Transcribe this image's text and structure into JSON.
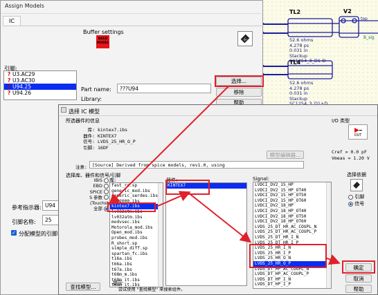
{
  "schematic": {
    "tl2": {
      "name": "TL2",
      "props": "52.6 ohms\n4.278 ps\n0.031 in\nStackup\nSC1254_3_D1-D"
    },
    "tl4": {
      "name": "TL4",
      "props": "52.6 ohms\n4.278 ps\n0.031 in\nStackup\nSC1254_3_D1+D"
    },
    "v2": {
      "name": "V2",
      "pin": "top",
      "part": "B_sig"
    }
  },
  "assign": {
    "title": "Assign Models",
    "tab": "IC",
    "buffer_settings": "Buffer settings",
    "need_model": "NEED\nMODEL",
    "pins_label": "引脚:",
    "pins": [
      {
        "mark": "?",
        "name": "U3.AC29"
      },
      {
        "mark": "?",
        "name": "U3.AC30"
      },
      {
        "mark": "?",
        "name": "U94.25"
      },
      {
        "mark": "?",
        "name": "U94.26"
      }
    ],
    "part_name_label": "Part name:",
    "part_name_value": "???U94",
    "library_label": "Library:",
    "select_button": "选择...",
    "remove_button": "移除",
    "help_button": "帮助",
    "ref_label": "参考指示器:",
    "ref_value": "U94",
    "pin_name_label": "引脚名称:",
    "pin_name_value": "25",
    "assign_checkbox_label": "分配模型的引脚名称"
  },
  "icdlg": {
    "title": "选择 IC 模型",
    "selected_info_label": "所选器件的信息",
    "info": {
      "lib_label": "库:",
      "lib_value": "kintex7.ibs",
      "dev_label": "器件:",
      "dev_value": "KINTEX7",
      "sig_label": "信号:",
      "sig_value": "LVDS_25_HR_O_P",
      "pin_label": "引脚:",
      "pin_value": "16DF",
      "note_label": "注意:",
      "note_value": "[Source]         Derived from spice models, rev1.0, using"
    },
    "io_type_label": "I/O 类型",
    "io_out": "OUT",
    "cref": "Cref = 0.0 pF",
    "vmeas": "Vmeas = 1.20 V",
    "model_editor_button": "模型编辑器...",
    "select_lib_label": "选择库、器件和信号/引脚",
    "lib_col": "库:",
    "dev_col": "器件:",
    "signal_col": "Signal:",
    "filters": [
      "IBIS",
      "EBD",
      "SPICE",
      "S 参数",
      "(Touchstone)",
      "全部"
    ],
    "libraries": [
      "fast_rc.sp",
      "generic_mod.ibs",
      "generic_serdes.ibs",
      "hyp2000.ibs",
      "kintex7.ibs",
      "lv032atm.ibs",
      "lv032atm.ibs",
      "modvsec.ibs",
      "Motorola_mod.ibs",
      "Open_mod.ibs",
      "probes_mod.ibs",
      "R_short.sp",
      "simple_diff.sp",
      "spartan_fc.ibs",
      "t16a.ibs",
      "t66a.ibs",
      "t67a.ibs",
      "t68m_m.ibs",
      "t68m_it.ibs",
      "t68m_it.ibs"
    ],
    "devices": [
      "KINTEX7"
    ],
    "signals": [
      "LVDCI_DV2_15_HP",
      "LVDCI_DV2_15_HP_OT40",
      "LVDCI_DV2_15_HP_OT50",
      "LVDCI_DV2_15_HP_OT60",
      "LVDCI_DV2_18_HP",
      "LVDCI_DV2_18_HP_OT40",
      "LVDCI_DV2_18_HP_OT50",
      "LVDCI_DV2_18_HP_OT60",
      "LVDS_25_DT_HR_AC_COUPL_N",
      "LVDS_25_DT_HR_AC_COUPL_P",
      "LVDS_25_DT_HR_I_N",
      "LVDS_25_DT_HR_I_P",
      "LVDS_25_HR_I_N",
      "LVDS_25_HR_I_P",
      "LVDS_25_HR_O_N",
      "LVDS_25_HR_O_P",
      "LVDS_DT_HP_AC_COUPL_N",
      "LVDS_DT_HP_AC_COUPL_P",
      "LVDS_DT_HP_I_N",
      "LVDS_DT_HP_I_P"
    ],
    "selected_signal_index": 15,
    "select_by_label": "选择依据",
    "select_by": [
      "引脚",
      "信号"
    ],
    "find_model_button": "查找模型...",
    "hint_label": "提示",
    "hint_text": "尝试使用 \"查找模型\" 来搜索组件。",
    "ok_button": "确定",
    "cancel_button": "取消",
    "help_button": "帮助"
  }
}
